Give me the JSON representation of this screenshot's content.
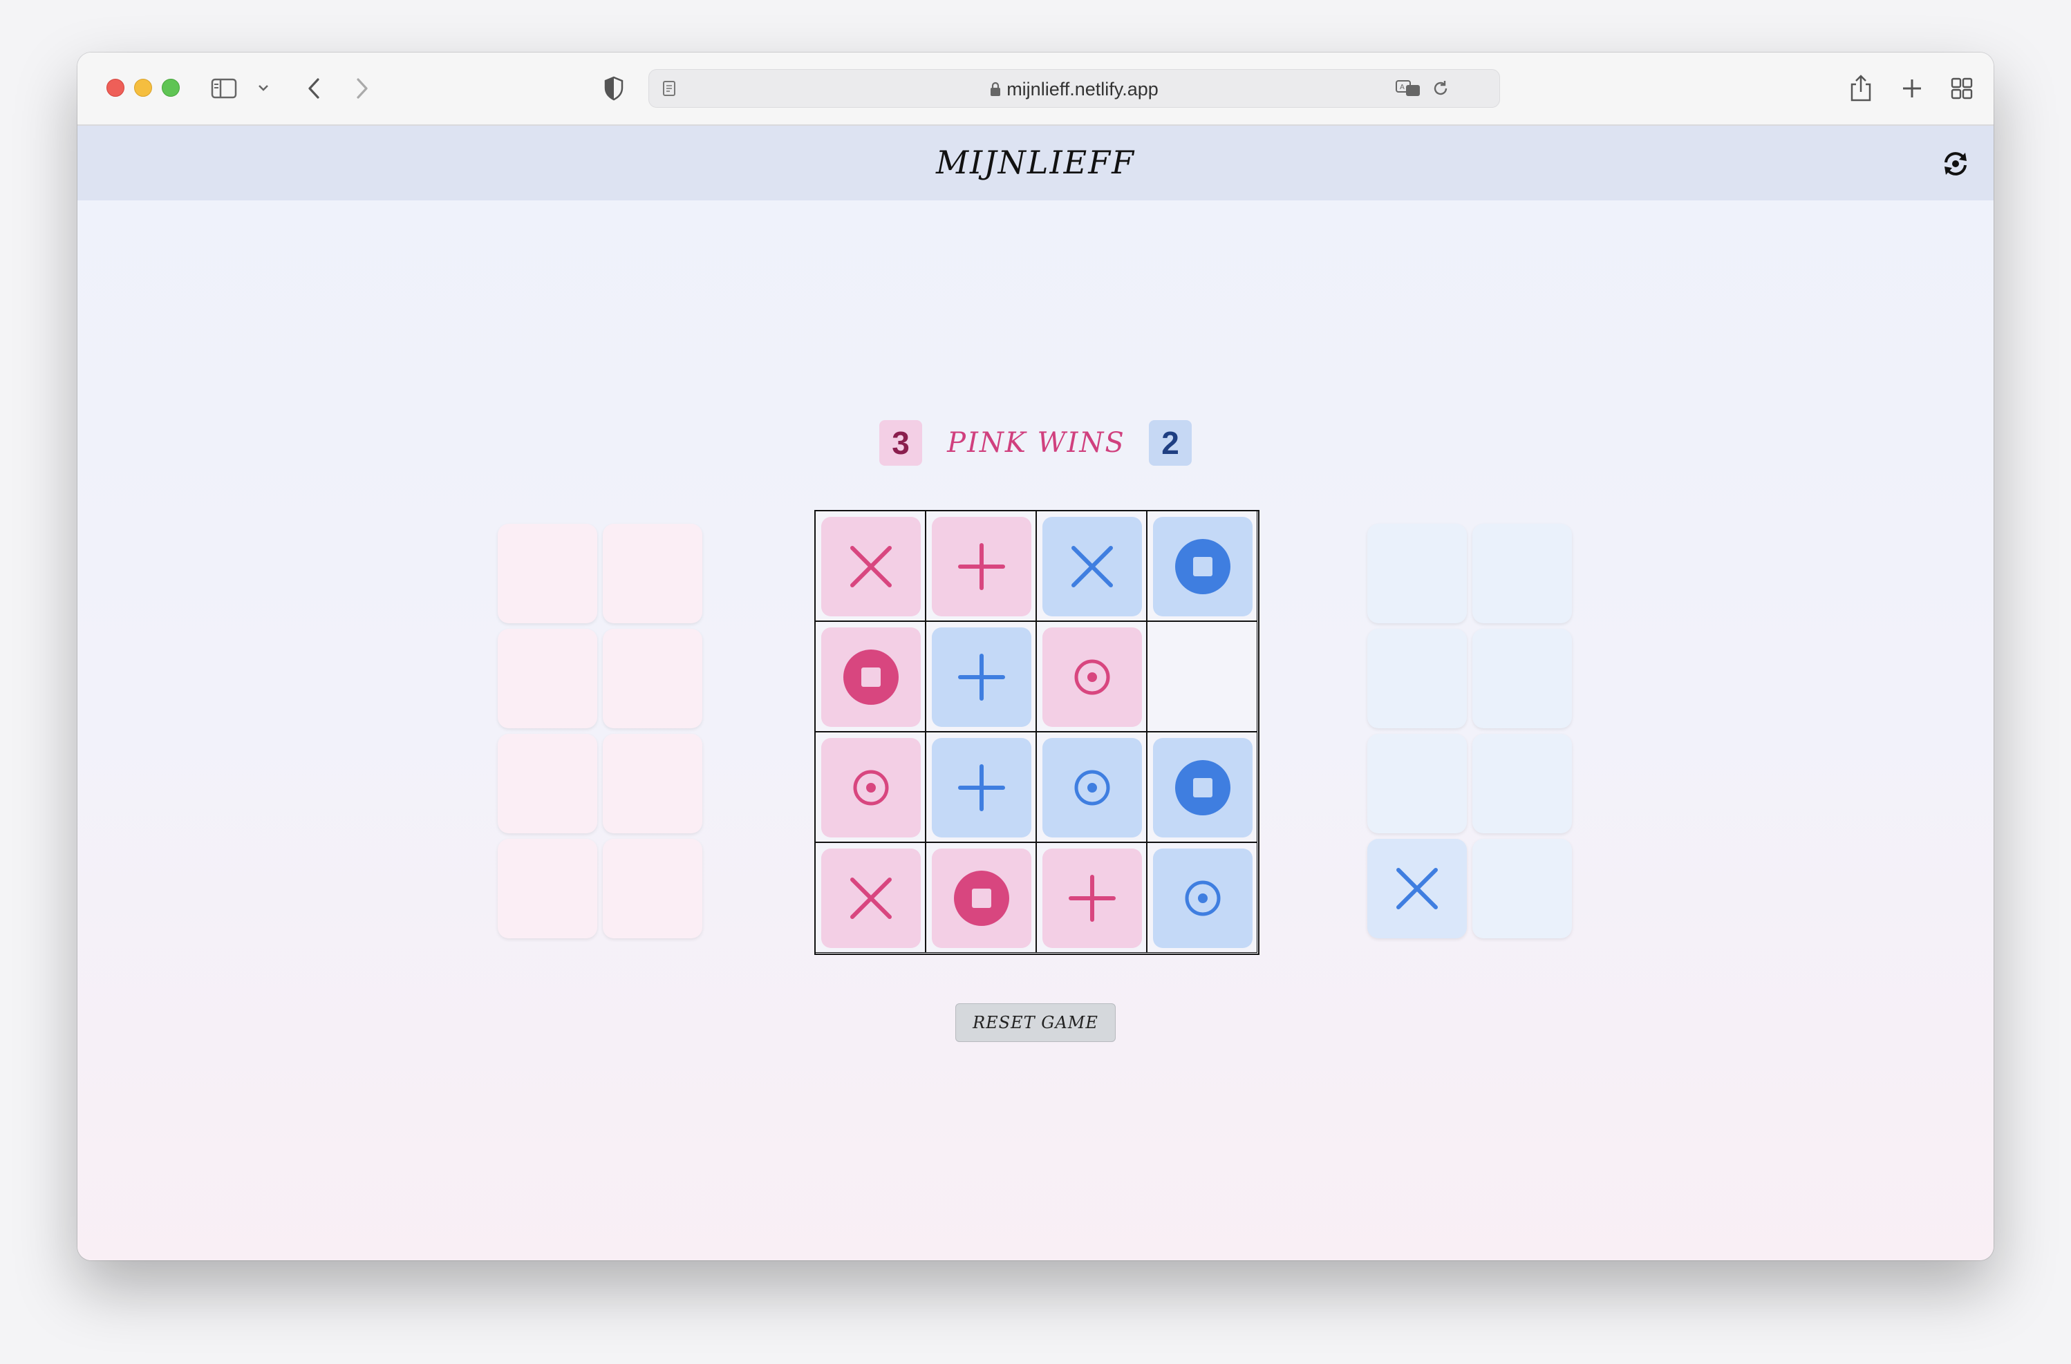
{
  "browser": {
    "url": "mijnlieff.netlify.app"
  },
  "app": {
    "title": "MIJNLIEFF"
  },
  "status": {
    "pink_score": "3",
    "blue_score": "2",
    "message": "PINK WINS"
  },
  "colors": {
    "pink_tile": "#f3cfe5",
    "pink_symbol": "#d8467f",
    "blue_tile": "#c4d9f7",
    "blue_symbol": "#3f7ee0",
    "pink_tray_empty": "#fbeef5",
    "blue_tray_empty": "#eaf1fb",
    "pink_score_bg": "#f3cfe5",
    "blue_score_bg": "#c6d8f4"
  },
  "board": {
    "rows": [
      [
        {
          "player": "pink",
          "symbol": "diagonal-x"
        },
        {
          "player": "pink",
          "symbol": "straight-plus"
        },
        {
          "player": "blue",
          "symbol": "diagonal-x"
        },
        {
          "player": "blue",
          "symbol": "pusher-square"
        }
      ],
      [
        {
          "player": "pink",
          "symbol": "pusher-square"
        },
        {
          "player": "blue",
          "symbol": "straight-plus"
        },
        {
          "player": "pink",
          "symbol": "puller-dot"
        },
        {
          "player": "empty",
          "symbol": ""
        }
      ],
      [
        {
          "player": "pink",
          "symbol": "puller-dot"
        },
        {
          "player": "blue",
          "symbol": "straight-plus"
        },
        {
          "player": "blue",
          "symbol": "puller-dot"
        },
        {
          "player": "blue",
          "symbol": "pusher-square"
        }
      ],
      [
        {
          "player": "pink",
          "symbol": "diagonal-x"
        },
        {
          "player": "pink",
          "symbol": "pusher-square"
        },
        {
          "player": "pink",
          "symbol": "straight-plus"
        },
        {
          "player": "blue",
          "symbol": "puller-dot"
        }
      ]
    ]
  },
  "pink_tray": [
    {
      "symbol": ""
    },
    {
      "symbol": ""
    },
    {
      "symbol": ""
    },
    {
      "symbol": ""
    },
    {
      "symbol": ""
    },
    {
      "symbol": ""
    },
    {
      "symbol": ""
    },
    {
      "symbol": ""
    }
  ],
  "blue_tray": [
    {
      "symbol": ""
    },
    {
      "symbol": ""
    },
    {
      "symbol": ""
    },
    {
      "symbol": ""
    },
    {
      "symbol": ""
    },
    {
      "symbol": ""
    },
    {
      "symbol": "diagonal-x"
    },
    {
      "symbol": ""
    }
  ],
  "controls": {
    "reset_label": "RESET GAME"
  }
}
